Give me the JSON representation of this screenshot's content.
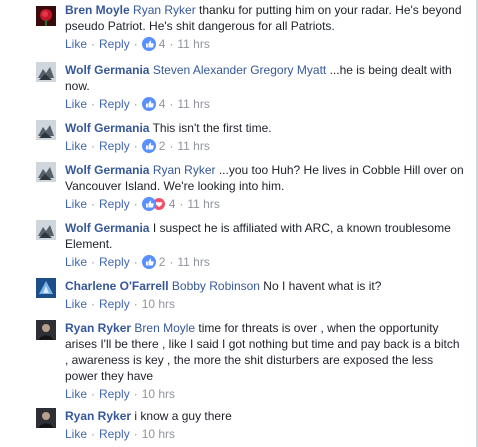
{
  "colors": {
    "link": "#365899",
    "action": "#4267b2",
    "meta": "#90949c",
    "like_blue": "#5890ff",
    "love_red": "#f25268"
  },
  "actions": {
    "like": "Like",
    "reply": "Reply",
    "separator": "·"
  },
  "comments": [
    {
      "author": "Bren Moyle",
      "mention": "Ryan Ryker",
      "text": " thanku for putting him on your radar. He's beyond pseudo Patriot. He's shit dangerous for all Patriots.",
      "reactions": "like-icon",
      "count": "4",
      "time": "11 hrs"
    },
    {
      "author": "Wolf Germania",
      "mention": "Steven Alexander Gregory Myatt",
      "text": " ...he is being dealt with now.",
      "reactions": "like-icon",
      "count": "4",
      "time": "11 hrs"
    },
    {
      "author": "Wolf Germania",
      "mention": "",
      "text": "This isn't the first time.",
      "reactions": "like-icon",
      "count": "2",
      "time": "11 hrs"
    },
    {
      "author": "Wolf Germania",
      "mention": "Ryan Ryker",
      "text": " ...you too Huh? He lives in Cobble Hill over on Vancouver Island. We're looking into him.",
      "reactions": "like-and-love-icons",
      "count": "4",
      "time": "11 hrs"
    },
    {
      "author": "Wolf Germania",
      "mention": "",
      "text": "I suspect he is affiliated with ARC, a known troublesome Element.",
      "reactions": "like-icon",
      "count": "2",
      "time": "11 hrs"
    },
    {
      "author": "Charlene O'Farrell",
      "mention": "Bobby Robinson",
      "text": " No I havent what is it?",
      "reactions": "",
      "count": "",
      "time": "10 hrs"
    },
    {
      "author": "Ryan Ryker",
      "mention": "Bren Moyle",
      "text": " time for threats is over , when the opportunity arises I'll be there , like I said I got nothing but time and pay back is a bitch , awareness is key , the more the shit disturbers are exposed the less power they have",
      "reactions": "",
      "count": "",
      "time": "10 hrs"
    },
    {
      "author": "Ryan Ryker",
      "mention": "",
      "text": "i know a guy there",
      "reactions": "",
      "count": "",
      "time": "10 hrs"
    }
  ]
}
